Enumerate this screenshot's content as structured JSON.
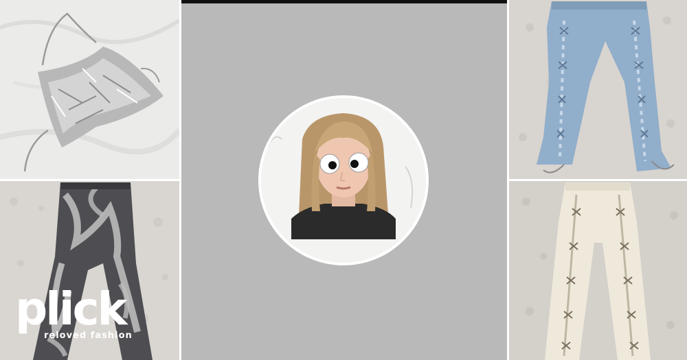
{
  "brand": {
    "name": "plick",
    "tagline": "reloved fashion"
  },
  "grid": {
    "tiles": [
      {
        "item": "silver-chainmail-halter-top-icon"
      },
      {
        "item": "black-grey-bleached-jeans-icon"
      },
      {
        "item": "light-blue-lace-up-jeans-icon"
      },
      {
        "item": "cream-lace-up-trousers-icon"
      }
    ]
  },
  "profile": {
    "avatar": "profile-photo-with-googly-eyes"
  },
  "colors": {
    "center_panel": "#b9b9b9",
    "top_bar": "#111111",
    "avatar_ring": "#ffffff",
    "logo": "#ffffff"
  }
}
